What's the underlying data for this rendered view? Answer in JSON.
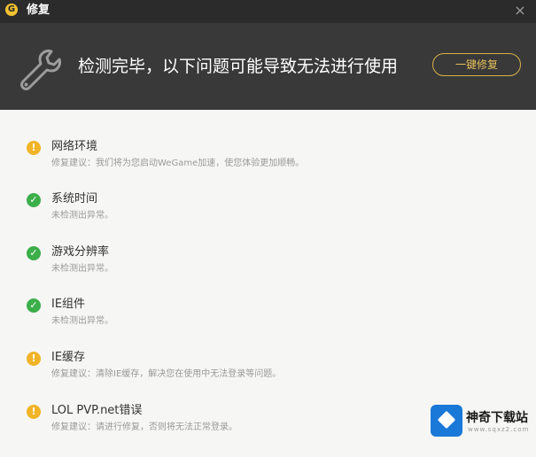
{
  "window": {
    "title": "修复",
    "logo_glyph": "G",
    "close_glyph": "×"
  },
  "header": {
    "message": "检测完毕，以下问题可能导致无法进行使用",
    "fix_all_label": "一键修复",
    "accent_color": "#e6c05a"
  },
  "items": [
    {
      "status": "warning",
      "glyph": "!",
      "title": "网络环境",
      "desc": "修复建议：我们将为您启动WeGame加速，使您体验更加顺畅。"
    },
    {
      "status": "ok",
      "glyph": "✓",
      "title": "系统时间",
      "desc": "未检测出异常。"
    },
    {
      "status": "ok",
      "glyph": "✓",
      "title": "游戏分辨率",
      "desc": "未检测出异常。"
    },
    {
      "status": "ok",
      "glyph": "✓",
      "title": "IE组件",
      "desc": "未检测出异常。"
    },
    {
      "status": "warning",
      "glyph": "!",
      "title": "IE缓存",
      "desc": "修复建议：清除IE缓存，解决您在使用中无法登录等问题。"
    },
    {
      "status": "warning",
      "glyph": "!",
      "title": "LOL PVP.net错误",
      "desc": "修复建议：请进行修复，否则将无法正常登录。"
    }
  ],
  "watermark": {
    "title": "神奇下载站",
    "subtitle": "www.sqxz2.com"
  }
}
